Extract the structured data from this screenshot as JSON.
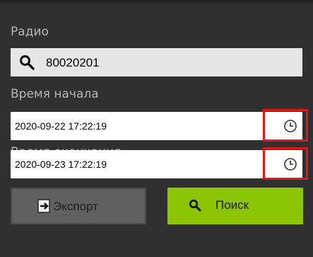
{
  "radio": {
    "label": "Радио",
    "search_icon": "search-icon",
    "value": "80020201"
  },
  "start_time": {
    "label": "Время начала",
    "value": "2020-09-22 17:22:19",
    "icon": "clock-icon"
  },
  "end_time": {
    "label": "Время окончания",
    "value": "2020-09-23 17:22:19",
    "icon": "clock-icon"
  },
  "buttons": {
    "export_label": "Экспорт",
    "export_icon": "export-icon",
    "search_label": "Поиск",
    "search_icon": "search-icon"
  },
  "colors": {
    "panel_bg": "#303030",
    "search_button": "#8bc504",
    "export_button": "#606060",
    "highlight": "#e01818"
  }
}
